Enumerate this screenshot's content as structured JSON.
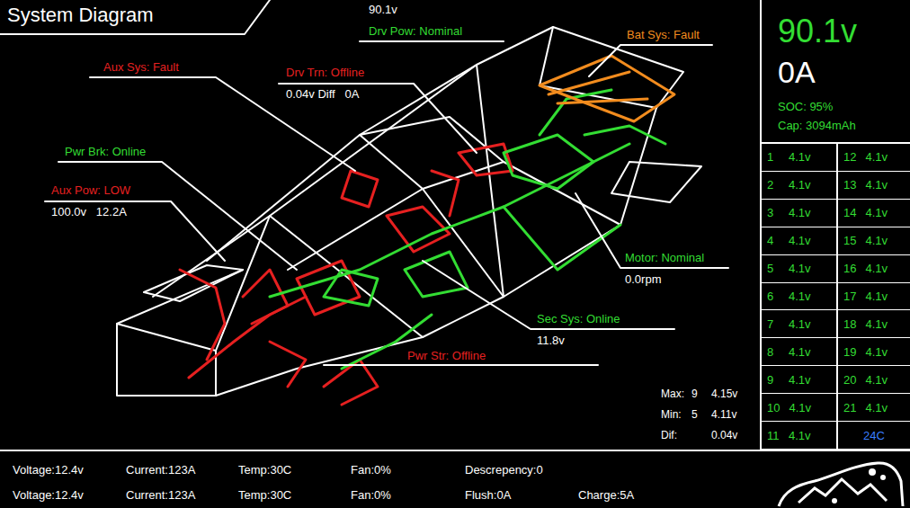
{
  "title": "System Diagram",
  "diagram": {
    "labels": [
      {
        "text": "Drv Pow: Nominal",
        "reading": "90.1v",
        "color": "#33dd33"
      },
      {
        "text": "Bat Sys: Fault",
        "color": "#f28c1e"
      },
      {
        "text": "Aux Sys: Fault",
        "color": "#e62020"
      },
      {
        "text": "Drv Trn: Offline",
        "reading": "0.04v Diff   0A",
        "color": "#e62020"
      },
      {
        "text": "Pwr Brk: Online",
        "color": "#33dd33"
      },
      {
        "text": "Aux Pow: LOW",
        "reading": "100.0v   12.2A",
        "color": "#e62020"
      },
      {
        "text": "Motor: Nominal",
        "reading": "0.0rpm",
        "color": "#33dd33"
      },
      {
        "text": "Sec Sys: Online",
        "reading": "11.8v",
        "color": "#33dd33"
      },
      {
        "text": "Pwr Str: Offline",
        "color": "#e62020"
      }
    ],
    "extremes": [
      {
        "label": "Max:",
        "cell": "9",
        "value": "4.15v"
      },
      {
        "label": "Min:",
        "cell": "5",
        "value": "4.11v"
      },
      {
        "label": "Dif:",
        "value": "0.04v"
      }
    ]
  },
  "pack": {
    "voltage": "90.1v",
    "current": "0A",
    "soc": "SOC: 95%",
    "capacity": "Cap: 3094mAh",
    "cells": [
      {
        "index": "1",
        "voltage": "4.1v"
      },
      {
        "index": "2",
        "voltage": "4.1v"
      },
      {
        "index": "3",
        "voltage": "4.1v"
      },
      {
        "index": "4",
        "voltage": "4.1v"
      },
      {
        "index": "5",
        "voltage": "4.1v"
      },
      {
        "index": "6",
        "voltage": "4.1v"
      },
      {
        "index": "7",
        "voltage": "4.1v"
      },
      {
        "index": "8",
        "voltage": "4.1v"
      },
      {
        "index": "9",
        "voltage": "4.1v"
      },
      {
        "index": "10",
        "voltage": "4.1v"
      },
      {
        "index": "11",
        "voltage": "4.1v"
      },
      {
        "index": "12",
        "voltage": "4.1v"
      },
      {
        "index": "13",
        "voltage": "4.1v"
      },
      {
        "index": "14",
        "voltage": "4.1v"
      },
      {
        "index": "15",
        "voltage": "4.1v"
      },
      {
        "index": "16",
        "voltage": "4.1v"
      },
      {
        "index": "17",
        "voltage": "4.1v"
      },
      {
        "index": "18",
        "voltage": "4.1v"
      },
      {
        "index": "19",
        "voltage": "4.1v"
      },
      {
        "index": "20",
        "voltage": "4.1v"
      },
      {
        "index": "21",
        "voltage": "4.1v"
      }
    ],
    "temperature": "24C"
  },
  "status_bar": {
    "rows": [
      [
        "Voltage:12.4v",
        "Current:123A",
        "Temp:30C",
        "Fan:0%",
        "Descrepency:0"
      ],
      [
        "Voltage:12.4v",
        "Current:123A",
        "Temp:30C",
        "Fan:0%",
        "Flush:0A",
        "Charge:5A"
      ]
    ]
  }
}
